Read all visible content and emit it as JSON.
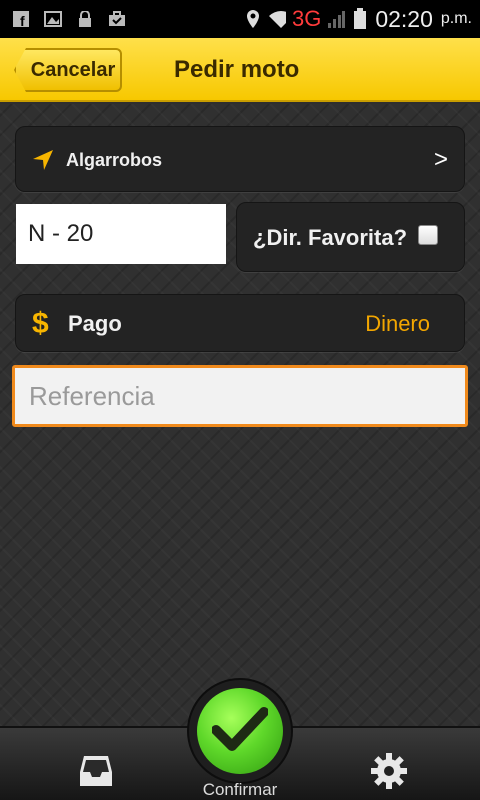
{
  "status_bar": {
    "network": "3G",
    "time": "02:20",
    "ampm": "p.m."
  },
  "header": {
    "cancel_label": "Cancelar",
    "title": "Pedir moto"
  },
  "address": {
    "text": "Algarrobos",
    "chevron": ">"
  },
  "number_field": {
    "value": "N - 20"
  },
  "favorite": {
    "label": "¿Dir. Favorita?",
    "checked": false
  },
  "payment": {
    "symbol": "$",
    "label": "Pago",
    "value": "Dinero"
  },
  "reference": {
    "placeholder": "Referencia",
    "value": ""
  },
  "bottom_bar": {
    "confirm_label": "Confirmar"
  },
  "colors": {
    "header_yellow": "#f7c800",
    "accent_orange": "#f08a1c",
    "payment_value": "#f2a600",
    "confirm_green": "#5fd82a"
  },
  "icons": [
    "facebook-icon",
    "image-icon",
    "lock-icon",
    "briefcase-icon",
    "location-pin-icon",
    "wifi-icon",
    "signal-icon",
    "battery-icon",
    "navigation-arrow-icon",
    "dollar-icon",
    "inbox-icon",
    "checkmark-icon",
    "gear-icon"
  ]
}
